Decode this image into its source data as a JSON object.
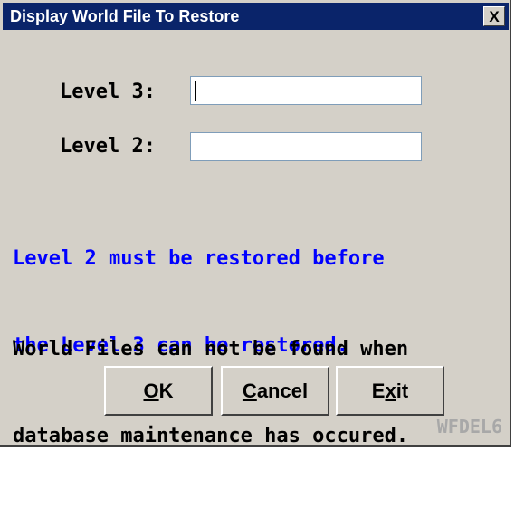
{
  "window": {
    "title": "Display World File To Restore",
    "close_glyph": "X"
  },
  "fields": {
    "level3_label": "Level 3:",
    "level3_value": "",
    "level2_label": "Level 2:",
    "level2_value": ""
  },
  "messages": {
    "blue_line1": "Level 2 must be restored before",
    "blue_line2": "the Level 3 can be restored.",
    "black_line1": "World Files can not be found when",
    "black_line2": "database maintenance has occured."
  },
  "buttons": {
    "ok_underline": "O",
    "ok_rest": "K",
    "cancel_underline": "C",
    "cancel_rest": "ancel",
    "exit_pre": "E",
    "exit_underline": "x",
    "exit_post": "it"
  },
  "footer": {
    "code": "WFDEL6"
  },
  "colors": {
    "titlebar_bg": "#0a246a",
    "window_bg": "#d4d0c8",
    "blue_text": "#0000ff",
    "watermark": "#a8a8a8"
  },
  "icons": {
    "close": "close-icon"
  }
}
